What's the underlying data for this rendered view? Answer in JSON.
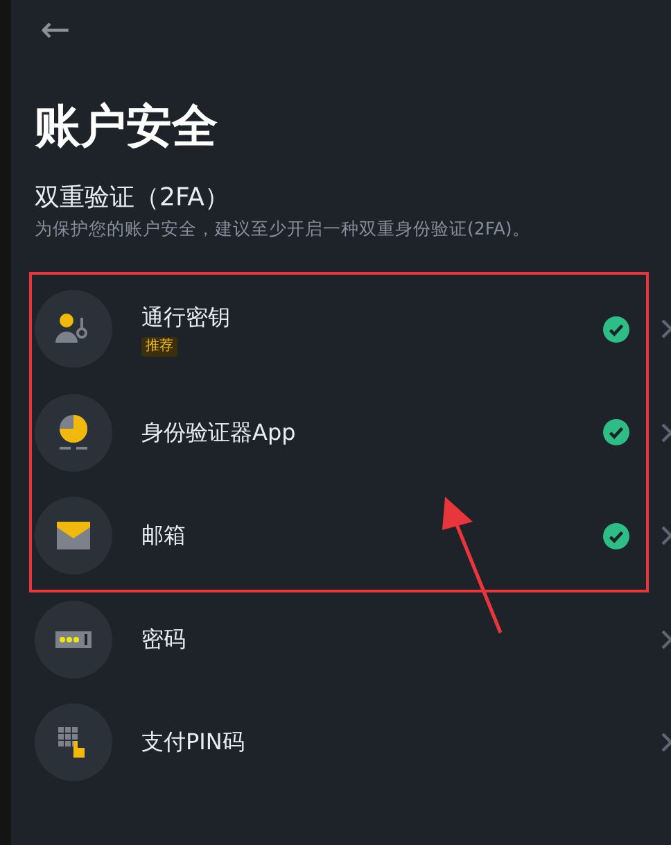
{
  "header": {
    "back": "←"
  },
  "title": "账户安全",
  "section": {
    "heading": "双重验证（2FA）",
    "description": "为保护您的账户安全，建议至少开启一种双重身份验证(2FA)。"
  },
  "groups": [
    {
      "framed": true,
      "items": [
        {
          "kind": "passkey",
          "label": "通行密钥",
          "badge": "推荐",
          "enabled": true
        },
        {
          "kind": "authenticator",
          "label": "身份验证器App",
          "enabled": true
        },
        {
          "kind": "email",
          "label": "邮箱",
          "enabled": true
        }
      ]
    },
    {
      "items": [
        {
          "kind": "password",
          "label": "密码",
          "enabled": false
        },
        {
          "kind": "pin",
          "label": "支付PIN码",
          "enabled": false
        }
      ]
    }
  ]
}
